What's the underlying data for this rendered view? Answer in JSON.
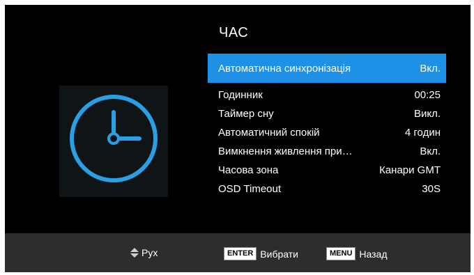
{
  "title": "ЧАС",
  "menu": {
    "items": [
      {
        "label": "Автоматична синхронізація",
        "value": "Вкл."
      },
      {
        "label": "Годинник",
        "value": "00:25"
      },
      {
        "label": "Таймер сну",
        "value": "Викл."
      },
      {
        "label": "Автоматичний спокій",
        "value": "4 годин"
      },
      {
        "label": "Вимкнення живлення при…",
        "value": "Вкл."
      },
      {
        "label": "Часова зона",
        "value": "Канари GMT"
      },
      {
        "label": "OSD Timeout",
        "value": "30S"
      }
    ]
  },
  "footer": {
    "move_label": "Рух",
    "enter_key": "ENTER",
    "enter_label": "Вибрати",
    "menu_key": "MENU",
    "menu_label": "Назад"
  },
  "colors": {
    "accent": "#1e90e6",
    "clock_stroke": "#2b9fe4",
    "background": "#000000",
    "footer": "#2d2d2d"
  },
  "icons": {
    "clock": "clock-icon",
    "move": "up-down-arrows-icon"
  }
}
